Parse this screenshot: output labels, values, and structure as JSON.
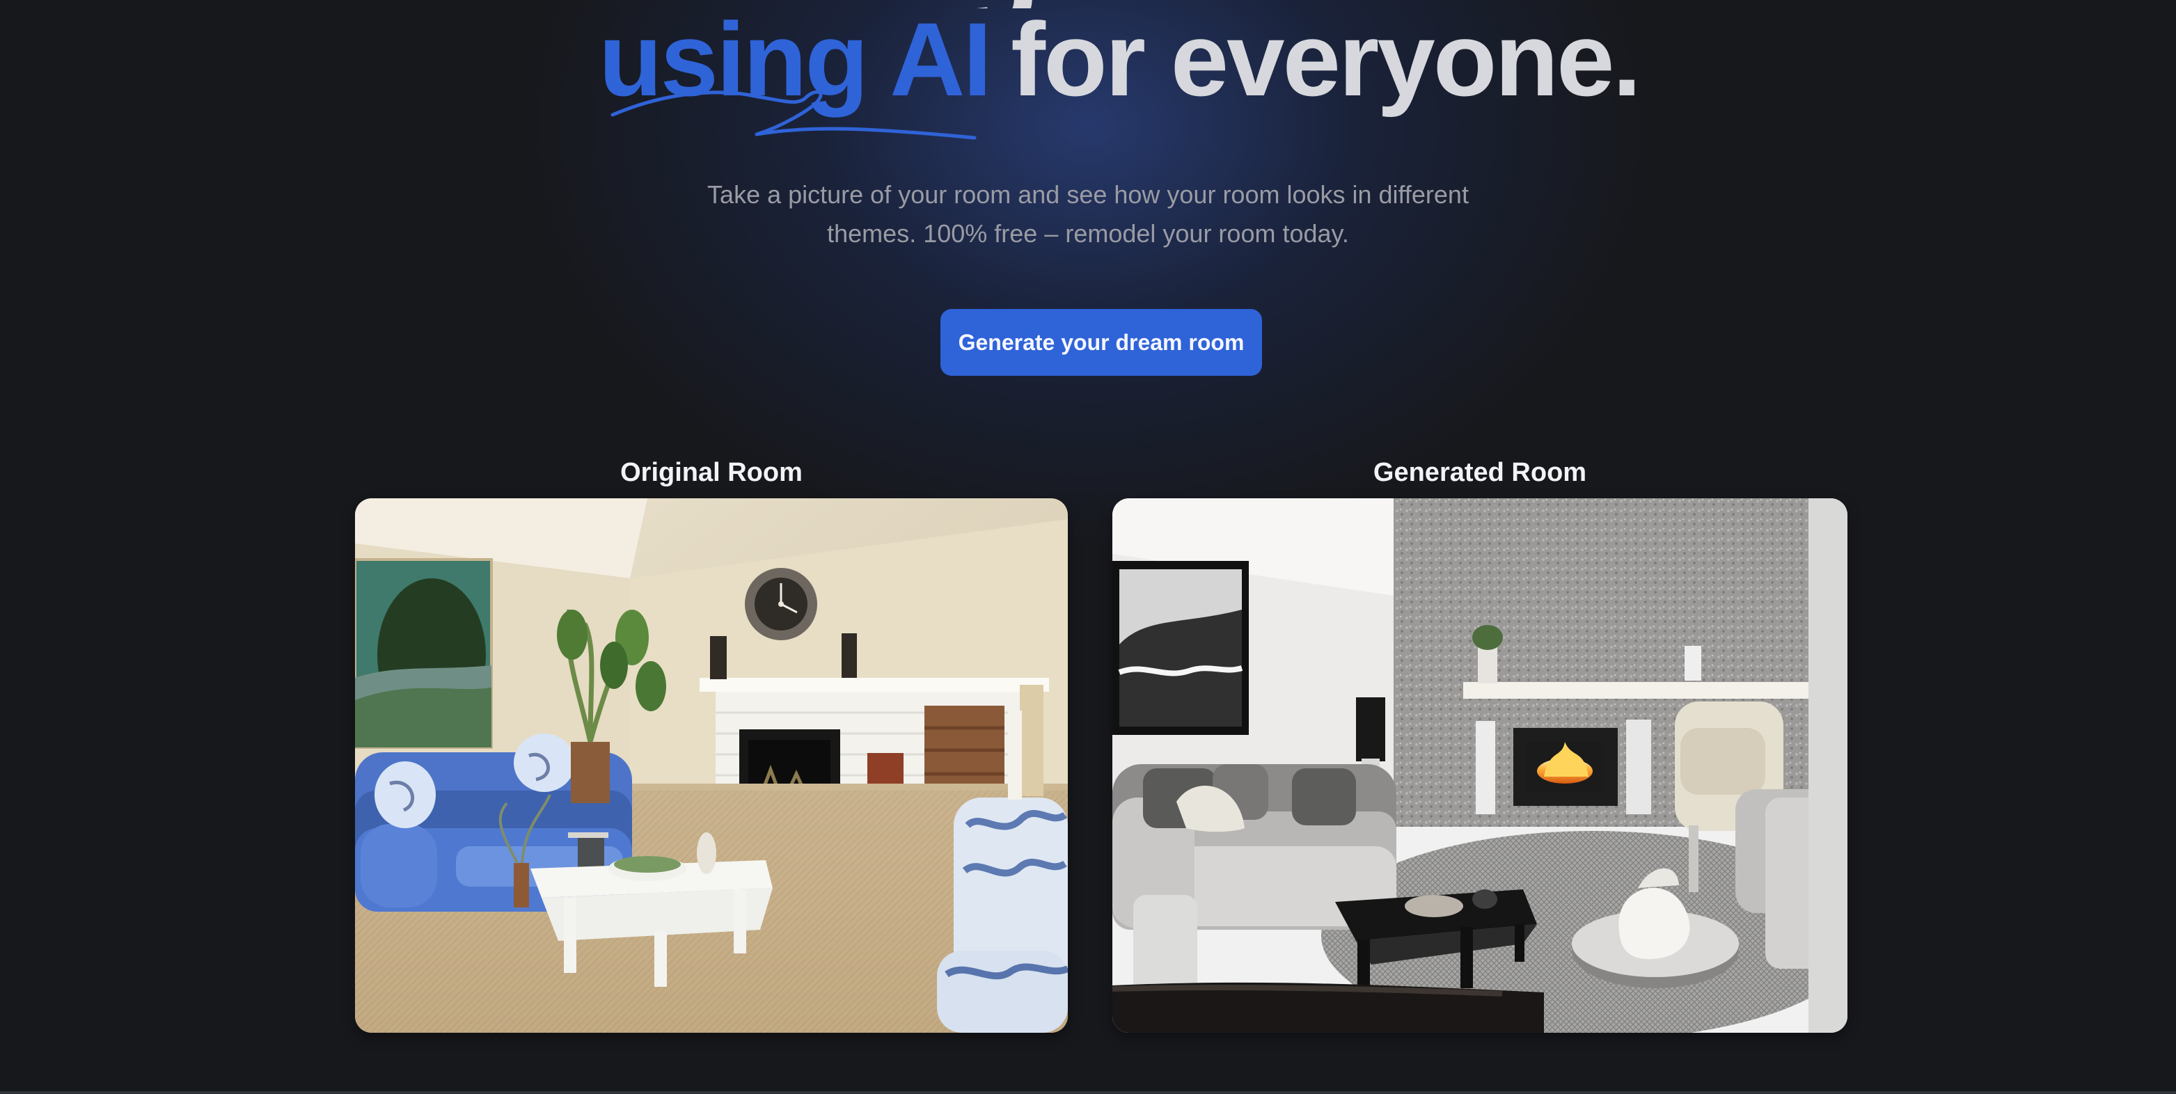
{
  "hero": {
    "cutoff_text": "g",
    "headline_accent": "using AI",
    "headline_rest": "for everyone.",
    "subtitle_line1": "Take a picture of your room and see how your room looks in different",
    "subtitle_line2": "themes. 100% free – remodel your room today.",
    "cta_label": "Generate your dream room"
  },
  "comparison": {
    "original_label": "Original Room",
    "generated_label": "Generated Room"
  },
  "images": {
    "original": {
      "alt": "Original Room"
    },
    "generated": {
      "alt": "Generated Room"
    }
  },
  "colors": {
    "background": "#17181c",
    "accent": "#2f63d8",
    "headline": "#d7d8dd",
    "subtitle": "#9a9ba4",
    "caption": "#f2f3f5"
  }
}
